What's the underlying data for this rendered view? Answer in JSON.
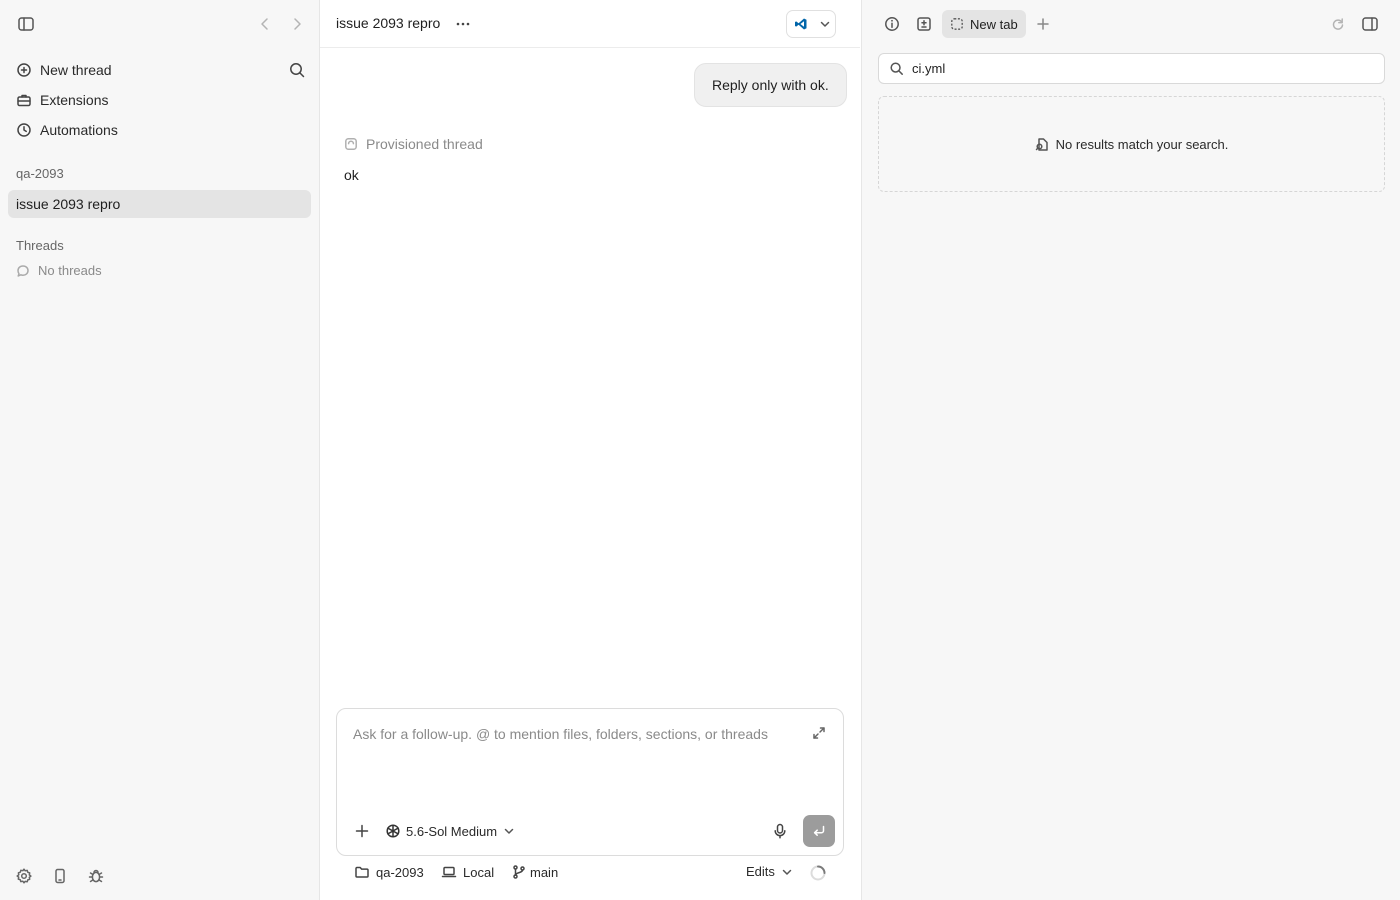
{
  "sidebar": {
    "menu": [
      {
        "label": "New thread",
        "icon": "plus-circle-icon"
      },
      {
        "label": "Extensions",
        "icon": "toolbox-icon"
      },
      {
        "label": "Automations",
        "icon": "clock-icon"
      }
    ],
    "project_group": "qa-2093",
    "active_thread": "issue 2093 repro",
    "threads_heading": "Threads",
    "threads_empty": "No threads",
    "bottom_icons": [
      "settings-icon",
      "phone-icon",
      "bug-icon"
    ]
  },
  "main": {
    "title": "issue 2093 repro",
    "open_in_app_icon": "vscode-icon",
    "user_message": "Reply only with ok.",
    "status_label": "Provisioned thread",
    "assistant_reply": "ok",
    "composer": {
      "placeholder": "Ask for a follow-up. @ to mention files, folders, sections, or threads",
      "model": "5.6-Sol Medium"
    },
    "footer": {
      "folder": "qa-2093",
      "environment": "Local",
      "branch": "main",
      "edits": "Edits"
    }
  },
  "right_panel": {
    "tab_label": "New tab",
    "search_value": "ci.yml",
    "empty_message": "No results match your search."
  },
  "colors": {
    "sidebar_bg": "#f7f7f7",
    "active_item_bg": "#e4e4e4",
    "send_button": "#9c9c9c",
    "vscode_blue": "#0065a9"
  }
}
